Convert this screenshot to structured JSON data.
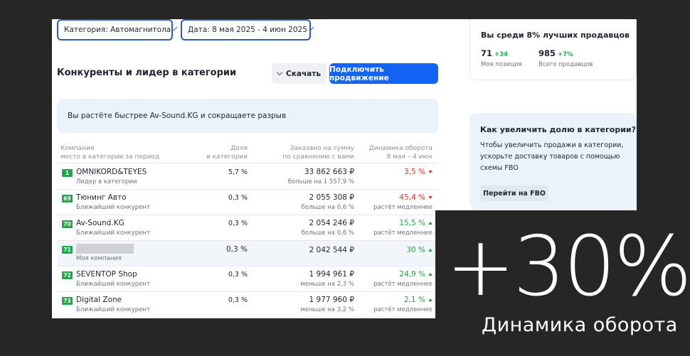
{
  "filters": {
    "category": "Категория: Автомагнитола",
    "date": "Дата: 8 мая 2025 - 4 июн 2025"
  },
  "section": {
    "title": "Конкуренты и лидер в категории",
    "download_label": "Скачать",
    "promote_label": "Подключить продвижение",
    "banner": "Вы растёте быстрее Av-Sound.KG и сокращаете разрыв"
  },
  "table": {
    "headers": {
      "company": "Компания",
      "company_sub": "место в категории за период",
      "share": "Доля",
      "share_sub": "в категории",
      "amount": "Заказано на сумму",
      "amount_sub": "по сравнению с вами",
      "dynamics": "Динамика оборота",
      "dynamics_sub": "8 мая – 4 июн"
    },
    "rows": [
      {
        "rank": "1",
        "name": "OMNIKORD&TEYES",
        "sub": "Лидер в категории",
        "share": "5,7 %",
        "amount": "33 862 663 ₽",
        "amount_sub": "больше на 1 557,9 %",
        "dyn": "3,5 %",
        "dyn_sub": "",
        "trend": "down"
      },
      {
        "rank": "69",
        "name": "Тюнинг Авто",
        "sub": "Ближайший конкурент",
        "share": "0,3 %",
        "amount": "2 055 308 ₽",
        "amount_sub": "больше на 0,6 %",
        "dyn": "45,4 %",
        "dyn_sub": "растёт медленнее",
        "trend": "down"
      },
      {
        "rank": "70",
        "name": "Av-Sound.KG",
        "sub": "Ближайший конкурент",
        "share": "0,3 %",
        "amount": "2 054 246 ₽",
        "amount_sub": "больше на 0,6 %",
        "dyn": "15,5 %",
        "dyn_sub": "растёт медленнее",
        "trend": "up"
      },
      {
        "rank": "71",
        "name": "",
        "sub": "Моя компания",
        "share": "0,3 %",
        "amount": "2 042 544 ₽",
        "amount_sub": "",
        "dyn": "30 %",
        "dyn_sub": "",
        "trend": "up"
      },
      {
        "rank": "72",
        "name": "SEVENTOP Shop",
        "sub": "Ближайший конкурент",
        "share": "0,3 %",
        "amount": "1 994 961 ₽",
        "amount_sub": "меньше на 2,3 %",
        "dyn": "24,9 %",
        "dyn_sub": "растёт медленнее",
        "trend": "up"
      },
      {
        "rank": "73",
        "name": "Digital Zone",
        "sub": "Ближайший конкурент",
        "share": "0,3 %",
        "amount": "1 977 960 ₽",
        "amount_sub": "меньше на 3,2 %",
        "dyn": "2,1 %",
        "dyn_sub": "растёт медленнее",
        "trend": "up"
      }
    ]
  },
  "top_card": {
    "title": "Вы среди 8% лучших продавцов",
    "position_value": "71",
    "position_delta": "+34",
    "position_label": "Моя позиция",
    "sellers_value": "985",
    "sellers_delta": "+7%",
    "sellers_label": "Всего продавцов"
  },
  "info_card": {
    "title": "Как увеличить долю в категории?",
    "text": "Чтобы увеличить продажи в категории, ускорьте доставку товаров с помощью схемы FBO",
    "button": "Перейти на FBO"
  },
  "overlay": {
    "big": "+30%",
    "caption": "Динамика оборота"
  },
  "colors": {
    "accent": "#1363f5",
    "positive": "#22a847",
    "negative": "#e0362c",
    "rank_badge": "#20a84a"
  }
}
